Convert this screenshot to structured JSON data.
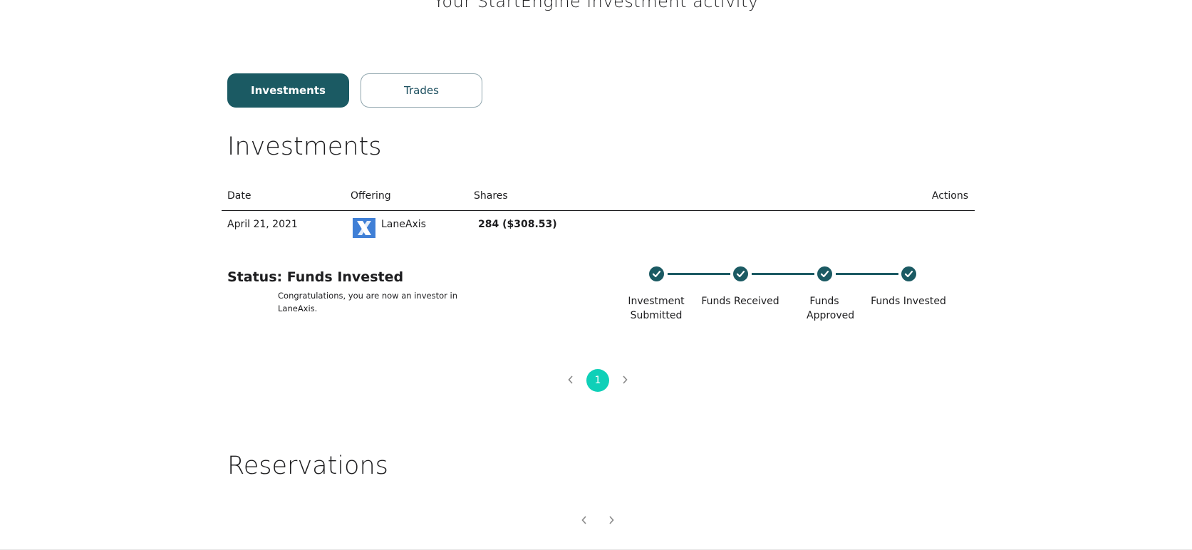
{
  "page": {
    "heading": "Your StartEngine investment activity"
  },
  "tabs": [
    {
      "label": "Investments",
      "active": true
    },
    {
      "label": "Trades",
      "active": false
    }
  ],
  "investments": {
    "title": "Investments",
    "columns": [
      "Date",
      "Offering",
      "Shares",
      "Actions"
    ],
    "rows": [
      {
        "date": "April 21, 2021",
        "offering": "LaneAxis",
        "shares": "284 ($308.53)"
      }
    ],
    "status": {
      "label": "Status: Funds Invested",
      "message": "Congratulations, you are now an investor in LaneAxis.",
      "steps": [
        {
          "label": "Investment Submitted",
          "complete": true
        },
        {
          "label": "Funds Received",
          "complete": true
        },
        {
          "label": "Funds Approved",
          "complete": true
        },
        {
          "label": "Funds Invested",
          "complete": true
        }
      ]
    },
    "pagination": {
      "current_page": "1"
    }
  },
  "reservations": {
    "title": "Reservations"
  },
  "colors": {
    "primary": "#1b5a63",
    "accent": "#0fd0b8",
    "logo": "#3f7fd6"
  },
  "icons": [
    "check-icon",
    "chevron-left-icon",
    "chevron-right-icon",
    "laneaxis-logo"
  ]
}
